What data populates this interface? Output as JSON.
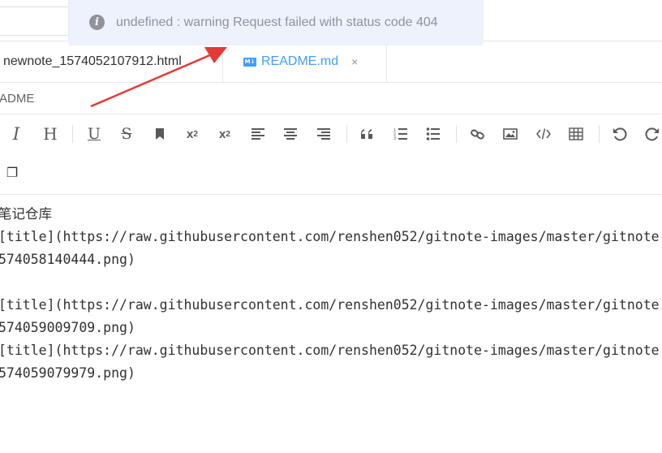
{
  "toast": {
    "icon": "info-icon",
    "message": "undefined : warning Request failed with status code 404"
  },
  "tabs": [
    {
      "label": "newnote_1574052107912.html"
    },
    {
      "icon": "markdown-icon",
      "icon_text": "M↓",
      "label": "README.md",
      "close": "×"
    }
  ],
  "breadcrumb": {
    "text": "ADME"
  },
  "toolbar": {
    "row1": [
      "italic-icon",
      "heading-icon",
      "underline-icon",
      "strikethrough-icon",
      "bookmark-icon",
      "superscript-icon",
      "subscript-icon",
      "align-left-icon",
      "align-center-icon",
      "align-right-icon",
      "quote-icon",
      "ordered-list-icon",
      "unordered-list-icon",
      "link-icon",
      "image-icon",
      "code-icon",
      "table-icon",
      "undo-icon",
      "redo-icon"
    ],
    "row2": [
      "fullscreen-icon"
    ],
    "italic": "I",
    "heading": "H",
    "underline": "U",
    "strike": "S",
    "sup_base": "x",
    "sup_exp": "2",
    "sub_base": "x",
    "sub_exp": "2",
    "row2_glyph": "❐"
  },
  "editor": {
    "lines": [
      "笔记仓库",
      "[title](https://raw.githubusercontent.com/renshen052/gitnote-images/master/gitnote",
      "574058140444.png)",
      "",
      "[title](https://raw.githubusercontent.com/renshen052/gitnote-images/master/gitnote",
      "574059009709.png)",
      "[title](https://raw.githubusercontent.com/renshen052/gitnote-images/master/gitnote",
      "574059079979.png)"
    ]
  },
  "colors": {
    "accent": "#409eff",
    "toast_bg": "#edf2fc",
    "toast_text": "#909399",
    "annotation_arrow": "#e53935"
  }
}
